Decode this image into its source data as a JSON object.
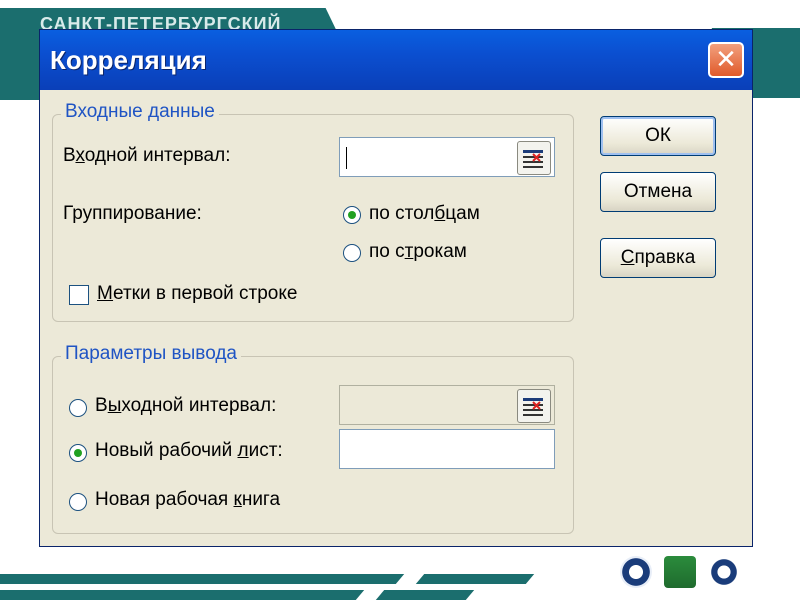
{
  "window": {
    "title": "Корреляция",
    "close_symbol": "✕"
  },
  "input_group": {
    "legend": "Входные данные",
    "input_range_label": "Входной интервал:",
    "input_range_value": "",
    "grouping_label": "Группирование:",
    "by_columns": "по столбцам",
    "by_rows": "по строкам",
    "labels_first_row": "Метки в первой строке",
    "grouping_selected": "по столбцам",
    "labels_checked": false
  },
  "output_group": {
    "legend": "Параметры вывода",
    "output_range": "Выходной интервал:",
    "new_sheet": "Новый рабочий лист:",
    "new_book": "Новая рабочая книга",
    "output_range_value": "",
    "new_sheet_value": "",
    "selected": "Новый рабочий лист:"
  },
  "buttons": {
    "ok": "ОК",
    "cancel": "Отмена",
    "help": "Справка"
  },
  "slide": {
    "header_text": "САНКТ-ПЕТЕРБУРГСКИЙ"
  },
  "colors": {
    "teal": "#1b6e6e",
    "titlebar": "#0b4fd0",
    "legend": "#1f54c4",
    "dialog_bg": "#ece9d8",
    "radio_dot": "#21a121"
  }
}
